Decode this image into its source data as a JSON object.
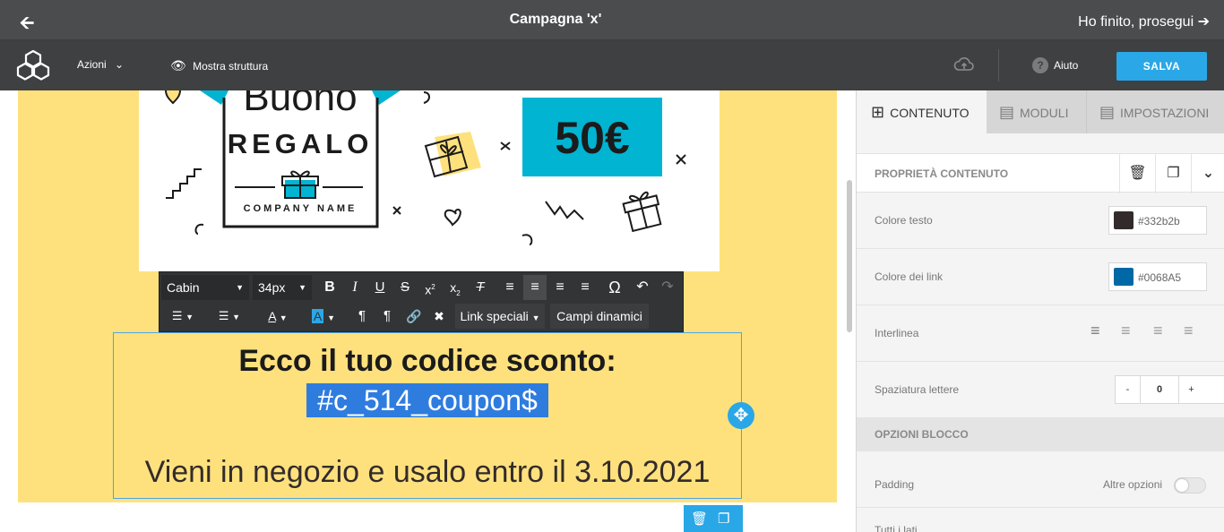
{
  "topbar": {
    "title": "Campagna 'x'",
    "finish_label": "Ho finito, prosegui"
  },
  "toolbar": {
    "azioni_label": "Azioni",
    "struttura_label": "Mostra struttura",
    "aiuto_label": "Aiuto",
    "salva_label": "SALVA"
  },
  "banner": {
    "buono": "Buono",
    "regalo": "REGALO",
    "company": "COMPANY NAME",
    "amount": "50€"
  },
  "editor": {
    "font_family": "Cabin",
    "font_size": "34px",
    "link_speciali": "Link speciali",
    "campi_dinamici": "Campi dinamici"
  },
  "content": {
    "heading": "Ecco il tuo codice sconto:",
    "coupon_code": "#c_514_coupon$",
    "subtext": "Vieni in negozio e usalo entro il 3.10.2021"
  },
  "panel": {
    "tabs": [
      {
        "label": "CONTENUTO",
        "icon": "grid-icon"
      },
      {
        "label": "MODULI",
        "icon": "modules-icon"
      },
      {
        "label": "IMPOSTAZIONI",
        "icon": "settings-list-icon"
      }
    ],
    "properties_title": "PROPRIETÀ CONTENUTO",
    "text_color_label": "Colore testo",
    "text_color_value": "#332b2b",
    "link_color_label": "Colore dei link",
    "link_color_value": "#0068A5",
    "line_height_label": "Interlinea",
    "letter_spacing_label": "Spaziatura lettere",
    "letter_spacing_value": "0",
    "minus": "-",
    "plus": "+",
    "block_options_title": "OPZIONI BLOCCO",
    "padding_label": "Padding",
    "more_options_label": "Altre opzioni",
    "all_sides_label": "Tutti i lati"
  },
  "colors": {
    "topbar_bg": "#4b4c4e",
    "accent": "#2aa7e6",
    "canvas_yellow": "#fee17d",
    "banner_teal": "#00b4d2",
    "selection": "#2f7cdf"
  }
}
